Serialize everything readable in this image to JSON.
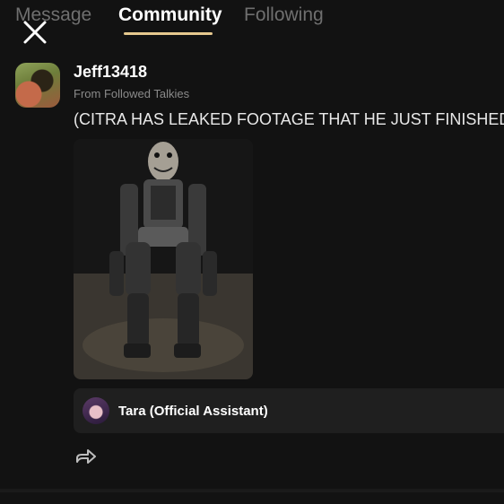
{
  "tabs": [
    {
      "label": "Message"
    },
    {
      "label": "Community",
      "active": true
    },
    {
      "label": "Following"
    }
  ],
  "post": {
    "username": "Jeff13418",
    "source": "From Followed Talkies",
    "text": "(CITRA HAS LEAKED FOOTAGE THAT HE JUST FINISHED NO",
    "image_icon": "animatronic-photo"
  },
  "assistant": {
    "name": "Tara (Official Assistant)"
  },
  "icons": {
    "close": "close-icon",
    "share": "share-icon"
  },
  "colors": {
    "background": "#121212",
    "accent": "#e5c88e",
    "inactive_tab": "#6f6f6f"
  }
}
